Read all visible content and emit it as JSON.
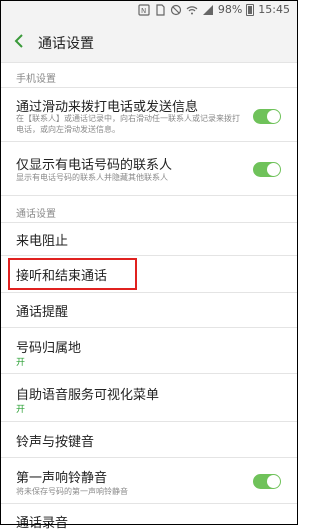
{
  "status": {
    "battery_percent": "98%",
    "time": "15:45",
    "icons": [
      "nfc-icon",
      "sim-icon",
      "blocked-icon",
      "wifi-icon",
      "signal-icon",
      "battery-icon"
    ]
  },
  "header": {
    "title": "通话设置",
    "back_icon": "chevron-left-icon"
  },
  "sections": {
    "phone": "手机设置",
    "call": "通话设置"
  },
  "items": {
    "swipe": {
      "title": "通过滑动来拨打电话或发送信息",
      "sub": "在【联系人】或通话记录中，向右滑动任一联系人或记录来拨打电话，或向左滑动发送信息。",
      "on": true
    },
    "only_numbers": {
      "title": "仅显示有电话号码的联系人",
      "sub": "显示有电话号码的联系人并隐藏其他联系人",
      "on": true
    },
    "block": {
      "title": "来电阻止"
    },
    "answer_end": {
      "title": "接听和结束通话"
    },
    "alerts": {
      "title": "通话提醒"
    },
    "location": {
      "title": "号码归属地",
      "value": "开"
    },
    "ivr": {
      "title": "自助语音服务可视化菜单",
      "value": "开"
    },
    "ringtone": {
      "title": "铃声与按键音"
    },
    "mute_first": {
      "title": "第一声响铃静音",
      "sub": "将未保存号码的第一声响铃静音",
      "on": true
    },
    "recording": {
      "title": "通话录音"
    }
  },
  "colors": {
    "toggle_on": "#6fc25a",
    "highlight": "#e0211f",
    "value_green": "#2aa034"
  }
}
